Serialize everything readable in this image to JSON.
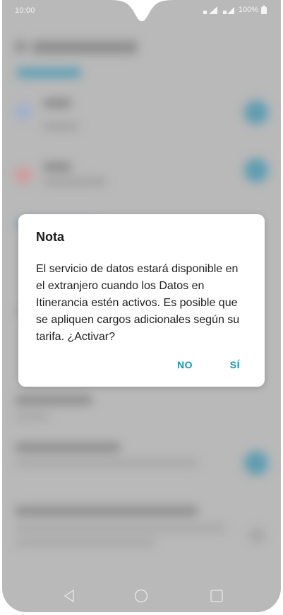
{
  "status_bar": {
    "time": "10:00",
    "battery_text": "100%",
    "icons": [
      "signal-icon",
      "wifi-icon",
      "battery-icon"
    ]
  },
  "dialog": {
    "title": "Nota",
    "message": "El servicio de datos estará disponible en el extranjero cuando los Datos en Itinerancia estén activos. Es posible que se apliquen cargos adicionales según su tarifa. ¿Activar?",
    "buttons": {
      "no": "NO",
      "yes": "SÍ"
    },
    "accent_color": "#1497b3"
  },
  "nav_bar": {
    "icons": [
      "back-icon",
      "home-icon",
      "recents-icon"
    ]
  }
}
